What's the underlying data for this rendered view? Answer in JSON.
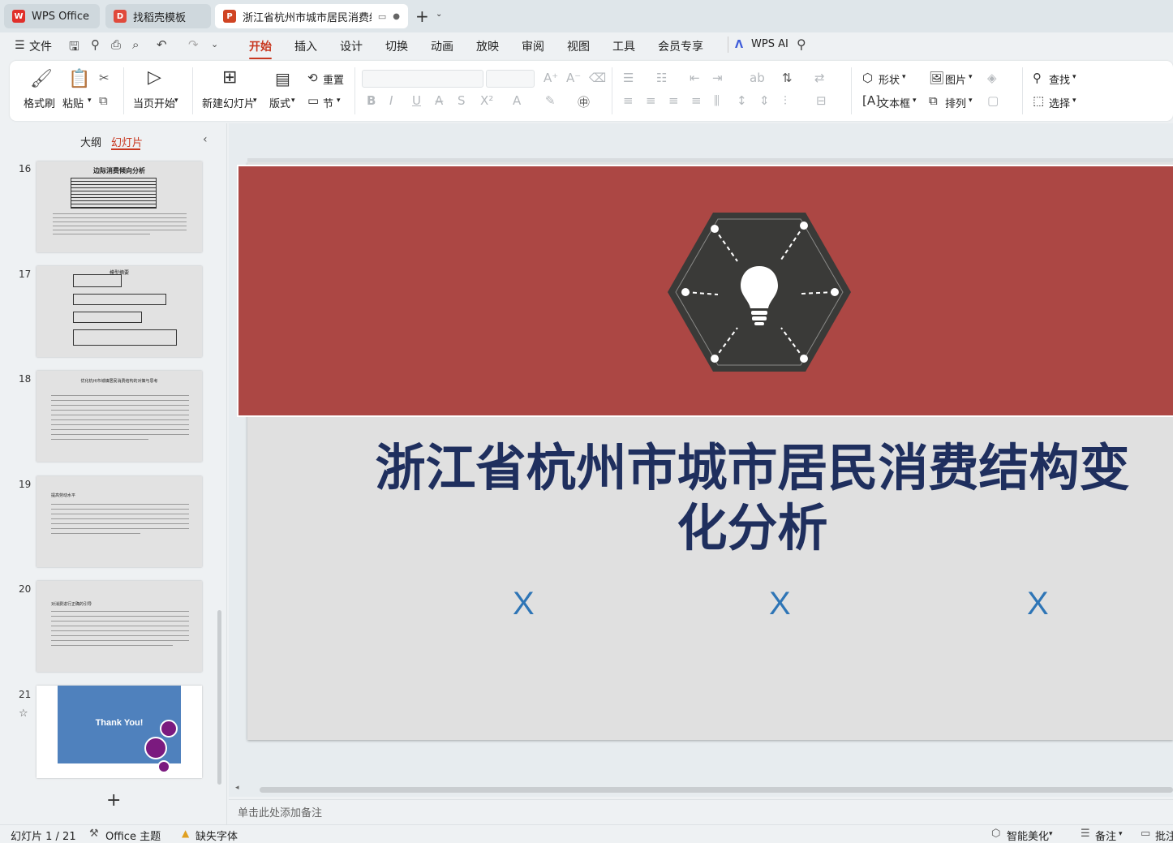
{
  "tabs": [
    {
      "label": "WPS Office",
      "icon": "wps-logo-icon"
    },
    {
      "label": "找稻壳模板",
      "icon": "docer-icon"
    },
    {
      "label": "浙江省杭州市城市居民消费结",
      "icon": "presentation-icon"
    }
  ],
  "new_tab": "+",
  "menu": {
    "file": "文件",
    "items": [
      "开始",
      "插入",
      "设计",
      "切换",
      "动画",
      "放映",
      "审阅",
      "视图",
      "工具",
      "会员专享"
    ],
    "ai": "WPS AI"
  },
  "ribbon": {
    "format_painter": "格式刷",
    "paste": "粘贴",
    "play_from_current": "当页开始",
    "new_slide": "新建幻灯片",
    "layout": "版式",
    "reset": "重置",
    "section": "节",
    "shape": "形状",
    "picture": "图片",
    "find": "查找",
    "textbox": "文本框",
    "arrange": "排列",
    "select": "选择"
  },
  "panel": {
    "outline_tab": "大纲",
    "slides_tab": "幻灯片"
  },
  "thumbnails": [
    {
      "num": "16",
      "title": "边际消费倾向分析"
    },
    {
      "num": "17",
      "title": "模型摘要"
    },
    {
      "num": "18",
      "title": "优化杭州市城镇居民消费结构的对策与思考"
    },
    {
      "num": "19",
      "title": "提高劳动水平"
    },
    {
      "num": "20",
      "title": "对消费进行正确的引导"
    },
    {
      "num": "21",
      "title": "Thank You!"
    }
  ],
  "add_slide": "+",
  "slide": {
    "title": "浙江省杭州市城市居民消费结构变化分析",
    "placeholders": [
      "X",
      "X",
      "X"
    ],
    "colors": {
      "banner": "#ac4744",
      "hexagon": "#3a3a38",
      "title": "#1f2f5e",
      "x": "#2e75b6"
    }
  },
  "notes_placeholder": "单击此处添加备注",
  "status": {
    "slide_counter": "幻灯片 1 / 21",
    "theme": "Office 主题",
    "missing_font": "缺失字体",
    "smart_beautify": "智能美化",
    "notes": "备注",
    "comments": "批注"
  }
}
